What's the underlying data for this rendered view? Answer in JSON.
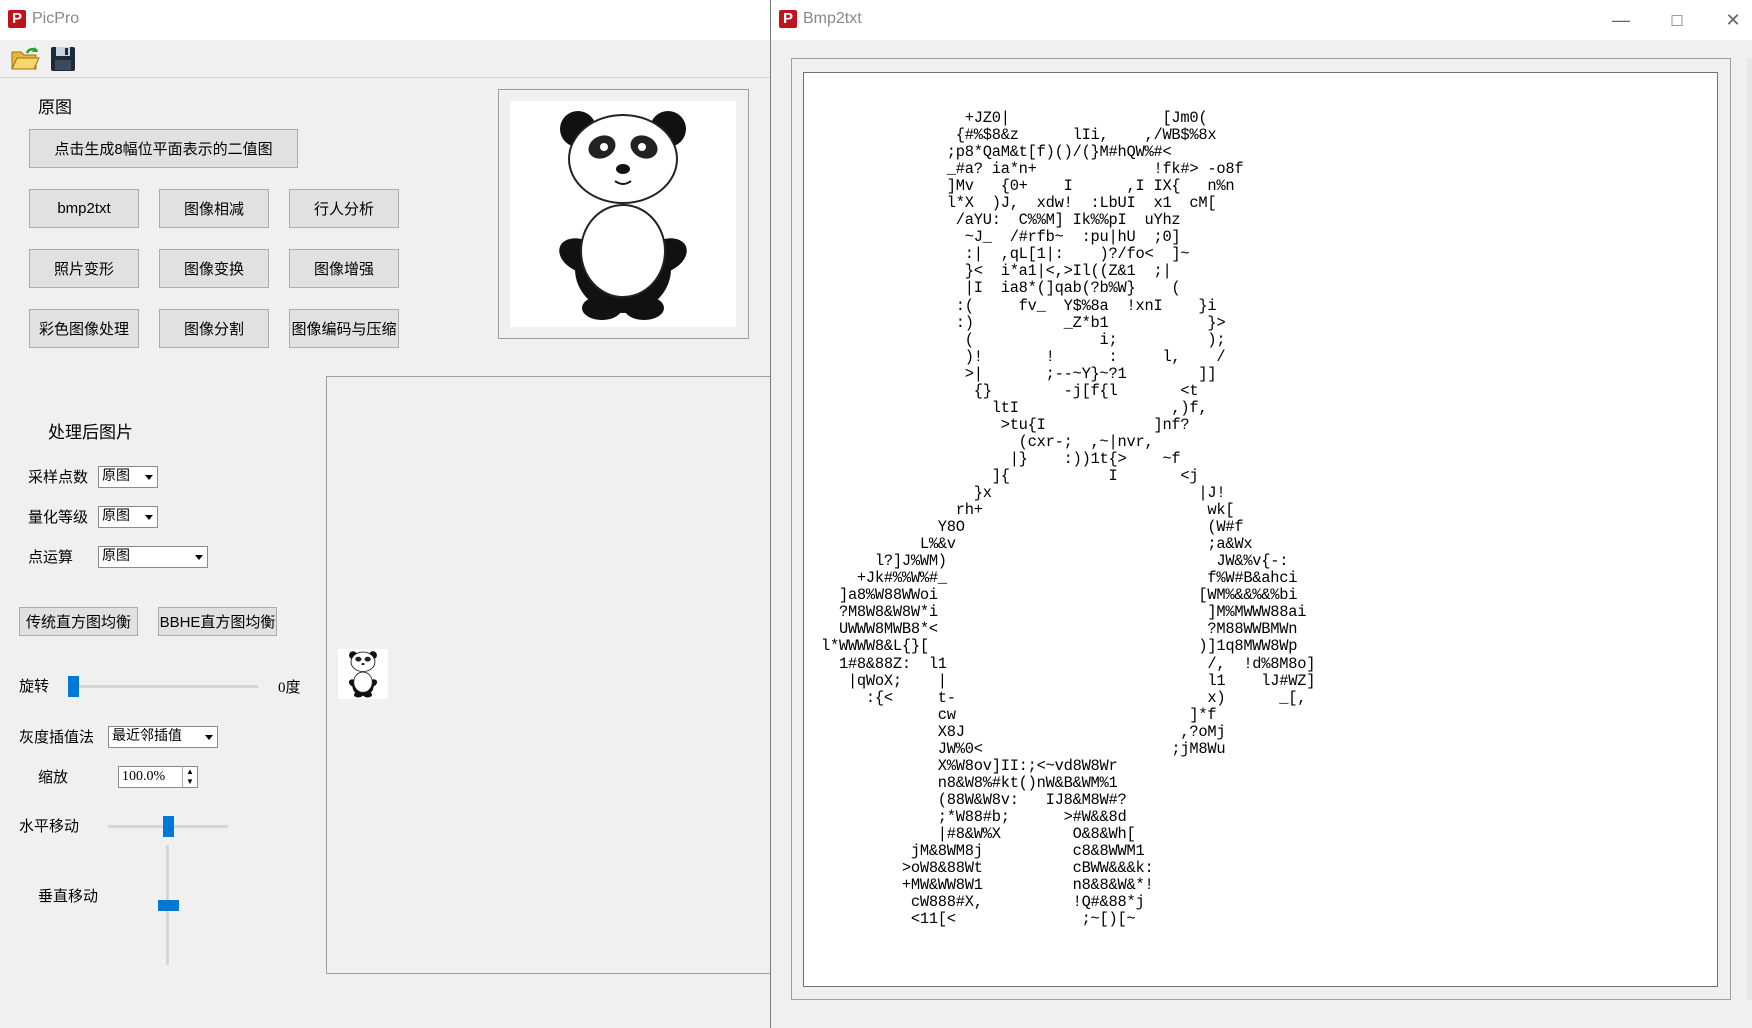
{
  "picpro": {
    "title": "PicPro",
    "toolbar": {
      "open_icon": "folder-open-icon",
      "save_icon": "save-disk-icon"
    },
    "original_label": "原图",
    "bitplane_button": "点击生成8幅位平面表示的二值图",
    "grid_buttons": [
      "bmp2txt",
      "图像相减",
      "行人分析",
      "照片变形",
      "图像变换",
      "图像增强",
      "彩色图像处理",
      "图像分割",
      "图像编码与压缩"
    ],
    "processed_label": "处理后图片",
    "sampling": {
      "label": "采样点数",
      "value": "原图"
    },
    "quantization": {
      "label": "量化等级",
      "value": "原图"
    },
    "point_op": {
      "label": "点运算",
      "value": "原图"
    },
    "hist_eq_button": "传统直方图均衡",
    "bbhe_button": "BBHE直方图均衡",
    "rotate": {
      "label": "旋转",
      "value_text": "0度",
      "level": 0
    },
    "interp": {
      "label": "灰度插值法",
      "value": "最近邻插值"
    },
    "zoom": {
      "label": "缩放",
      "value": "100.0%"
    },
    "hmove": {
      "label": "水平移动",
      "level": 0.5
    },
    "vmove": {
      "label": "垂直移动",
      "level": 0.5
    }
  },
  "bmp2txt": {
    "title": "Bmp2txt",
    "ascii_art": "                 +JZ0|                 [Jm0(\n                {#%$8&z      lIi,    ,/WB$%8x\n               ;p8*QaM&t[f)()/(}M#hQW%#<\n               _#a? ia*n+             !fk#> -o8f\n               ]Mv   {0+    I      ,I IX{   n%n\n               l*X  )J,  xdw!  :LbUI  x1  cM[\n                /aYU:  C%%M] Ik%%pI  uYhz\n                 ~J_  /#rfb~  :pu|hU  ;0]\n                 :|  ,qL[1|:    )?/fo<  ]~\n                 }<  i*a1|<,>Il((Z&1  ;|\n                 |I  ia8*(]qab(?b%W}    (\n                :(     fv_  Y$%8a  !xnI    }i\n                :)          _Z*b1           }>\n                 (              i;          );\n                 )!       !      :     l,    /\n                 >|       ;--~Y}~?1        ]]\n                  {}        -j[f{l       <t\n                    ltI                 ,)f,\n                     >tu{I            ]nf?\n                       (cxr-;  ,~|nvr,\n                      |}    :))1t{>    ~f\n                    ]{           I       <j\n                  }x                       |J!\n                rh+                         wk[\n              Y8O                           (W#f\n            L%&v                            ;a&Wx\n       l?]J%WM)                              JW&%v{-:\n     +Jk#%%W%#_                             f%W#B&ahci\n   ]a8%W88WWoi                             [WM%&&%&%bi\n   ?M8W8&W8W*i                              ]M%MWWW88ai\n   UWWW8MWB8*<                              ?M88WWBMWn\n l*WWWW8&L{}[                              )]1q8MWW8Wp\n   1#8&88Z:  l1                             /,  !d%8M8o]\n    |qWoX;    |                             l1    lJ#WZ]\n      :{<     t-                            x)      _[,\n              cw                          ]*f\n              X8J                        ,?oMj\n              JW%0<                     ;jM8Wu\n              X%W8ov]II:;<~vd8W8Wr\n              n8&W8%#kt()nW&B&WM%1\n              (88W&W8v:   IJ8&M8W#?\n              ;*W88#b;      >#W&&8d\n              |#8&W%X        O&8&Wh[\n           jM&8WM8j          c8&8WWM1\n          >oW8&88Wt          cBWW&&&k:\n          +MW&WW8W1          n8&8&W&*!\n           cW888#X,          !Q#&88*j\n           <11[<              ;~[)[~"
  }
}
